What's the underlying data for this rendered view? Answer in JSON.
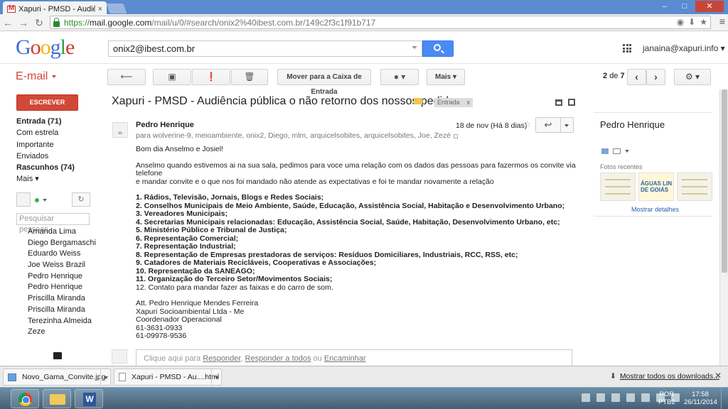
{
  "browser": {
    "tab_title": "Xapuri - PMSD - Audiênci",
    "tab_close": "×",
    "url_scheme": "https://",
    "url_host": "mail.google.com",
    "url_path": "/mail/u/0/#search/onix2%40ibest.com.br/149c2f3c1f91b717",
    "win_minimize": "–",
    "win_maximize": "□",
    "win_close": "✕",
    "omni_icons": [
      "◉",
      "⬇",
      "★"
    ],
    "menu": "≡"
  },
  "gmail": {
    "logo_letters": [
      "G",
      "o",
      "o",
      "g",
      "l",
      "e"
    ],
    "search_value": "onix2@ibest.com.br",
    "account": "janaina@xapuri.info ▾",
    "email_label": "E-mail",
    "toolbar": {
      "back": "⟵",
      "archive": "▣",
      "spam": "❗",
      "delete": "🗑",
      "move_to_inbox": "Mover para a Caixa de Entrada",
      "labels": "● ▾",
      "more": "Mais ▾",
      "pager_current": "2",
      "pager_of": "de",
      "pager_total": "7",
      "prev": "‹",
      "next": "›",
      "settings": "⚙ ▾"
    },
    "compose": "ESCREVER",
    "nav": [
      {
        "label": "Entrada (71)",
        "bold": true
      },
      {
        "label": "Com estrela",
        "bold": false
      },
      {
        "label": "Importante",
        "bold": false
      },
      {
        "label": "Enviados",
        "bold": false
      },
      {
        "label": "Rascunhos (74)",
        "bold": true
      },
      {
        "label": "Mais ▾",
        "bold": false
      }
    ],
    "chat": {
      "hangout_icon": "↻",
      "search_placeholder": "Pesquisar pessoas...",
      "contacts": [
        "Amanda Lima",
        "Diego Bergamaschi",
        "Eduardo Weiss",
        "Joe Weiss Brazil",
        "Pedro Henrique",
        "Pedro Henrique",
        "Priscilla Miranda",
        "Priscilla Miranda",
        "Terezinha Almeida",
        "Zeze"
      ]
    }
  },
  "message": {
    "subject": "Xapuri - PMSD - Audiência pública o não retorno dos nossos pedidos.",
    "label_chip": "Entrada",
    "label_chip_x": "x",
    "sender": "Pedro Henrique",
    "recipients": "para wolverine-9, meioambiente, onix2, Diego, mlm, arquicelsobites, arquicelsobites, Joe, Zezé",
    "date": "18 de nov (Há 8 dias)",
    "star": "☆",
    "reply_icon": "↩",
    "greeting": "Bom dia Anselmo e Josiel!",
    "para1_line1": "Anselmo quando estivemos ai na sua sala, pedimos para voce uma relação com os dados das pessoas para fazermos os convite via telefone",
    "para1_line2": "e mandar convite e o que nos foi mandado não atende as expectativas e foi te mandar novamente a relação",
    "list": [
      "1. Rádios, Televisão, Jornais, Blogs e Redes Sociais;",
      "2. Conselhos Municipais de Meio Ambiente, Saúde, Educação, Assistência Social, Habitação e Desenvolvimento Urbano;",
      "3. Vereadores Municipais;",
      "4. Secretarias Municipais relacionadas: Educação, Assistência Social, Saúde, Habitação, Desenvolvimento Urbano, etc;",
      "5. Ministério Público e Tribunal de Justiça;",
      "6. Representação Comercial;",
      "7. Representação Industrial;",
      "8. Representação de Empresas prestadoras de serviços: Resíduos Domiciliares, Industriais, RCC, RSS, etc;",
      "9. Catadores de Materiais Recicláveis, Cooperativas e Associações;",
      "10. Representação da SANEAGO;",
      "11. Organização do Terceiro Setor/Movimentos Sociais;",
      "12. Contato para mandar fazer as faixas e do carro de som."
    ],
    "signature": [
      "Att. Pedro Henrique Mendes Ferreira",
      "Xapuri Socioambiental Ltda - Me",
      "Coordenador Operacional",
      "61-3631-0933",
      "61-09978-9536"
    ],
    "reply_prefix": "Clique aqui para",
    "reply_link": "Responder",
    "reply_all_link": "Responder a todos",
    "reply_or": "ou",
    "forward_link": "Encaminhar"
  },
  "right_panel": {
    "name": "Pedro Henrique",
    "photos_label": "Fotos recentes",
    "photo_text": "ÁGUAS LIN DE GOIÁS",
    "details_link": "Mostrar detalhes"
  },
  "downloads": {
    "items": [
      "Novo_Gama_Convite.jpg",
      "Xapuri - PMSD - Au....html"
    ],
    "show_all": "Mostrar todos os downloads...",
    "close": "✕"
  },
  "taskbar": {
    "word_letter": "W",
    "lang_line1": "POR",
    "lang_line2": "PTB2",
    "time": "17:58",
    "date": "26/11/2014"
  }
}
